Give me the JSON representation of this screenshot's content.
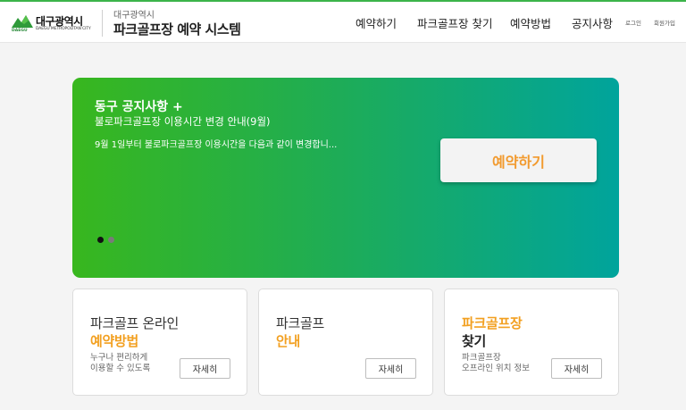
{
  "brand": {
    "city_name": "대구광역시",
    "city_en": "DAEGU METROPOLITAN CITY",
    "logo_tag": "DAEGU",
    "system_subtitle": "대구광역시",
    "system_title": "파크골프장 예약 시스템",
    "accent_color": "#3cb44a"
  },
  "nav": {
    "items": [
      {
        "label": "예약하기"
      },
      {
        "label": "파크골프장 찾기"
      },
      {
        "label": "예약방법"
      },
      {
        "label": "공지사항"
      }
    ],
    "login": "로그인",
    "signup": "회원가입"
  },
  "hero": {
    "title": "동구 공지사항 +",
    "subtitle": "불로파크골프장 이용시간 변경 안내(9월)",
    "description": "9월 1일부터 불로파크골프장 이용시간을 다음과 같이 변경합니...",
    "reserve_button": "예약하기",
    "slide_count": 2,
    "active_slide": 1,
    "gradient": [
      "#38b71e",
      "#00a49c"
    ],
    "button_text_color": "#f29a2e"
  },
  "cards": [
    {
      "line1": "파크골프 온라인",
      "line2": "예약방법",
      "desc1": "누구나 편리하게",
      "desc2": "이용할 수 있도록",
      "button": "자세히"
    },
    {
      "line1": "파크골프",
      "line2": "안내",
      "desc1": "",
      "desc2": "",
      "button": "자세히"
    },
    {
      "line1": "파크골프장",
      "line2": "찾기",
      "desc1": "파크골프장",
      "desc2": "오프라인 위치 정보",
      "button": "자세히"
    }
  ]
}
